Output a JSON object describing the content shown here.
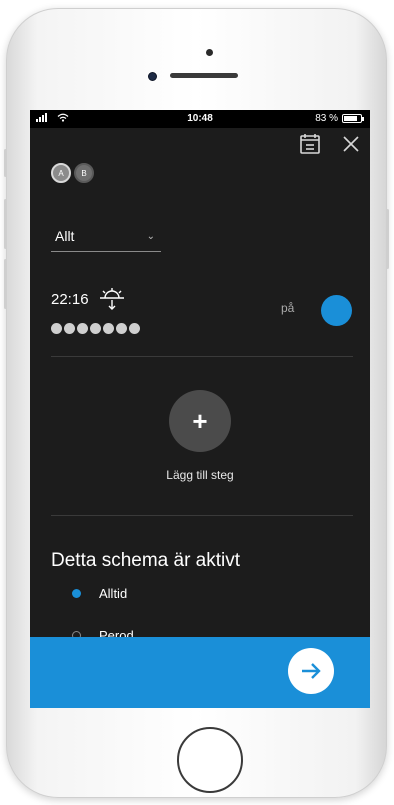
{
  "status_bar": {
    "time": "10:48",
    "battery": "83 %"
  },
  "header": {
    "calendar_icon": "calendar-icon",
    "close_icon": "close-icon"
  },
  "users": [
    {
      "label": "A"
    },
    {
      "label": "B"
    }
  ],
  "filter": {
    "selected": "Allt"
  },
  "schedule_step": {
    "time": "22:16",
    "icon": "sunset-icon",
    "days_count": 7,
    "status_label": "på",
    "enabled": true
  },
  "add_step": {
    "symbol": "+",
    "label": "Lägg till steg"
  },
  "active_section": {
    "heading": "Detta schema är aktivt",
    "options": [
      {
        "label": "Alltid",
        "selected": true
      },
      {
        "label": "Perod",
        "selected": false
      }
    ]
  },
  "colors": {
    "accent": "#1a8fd8",
    "background": "#1c1c1c"
  }
}
